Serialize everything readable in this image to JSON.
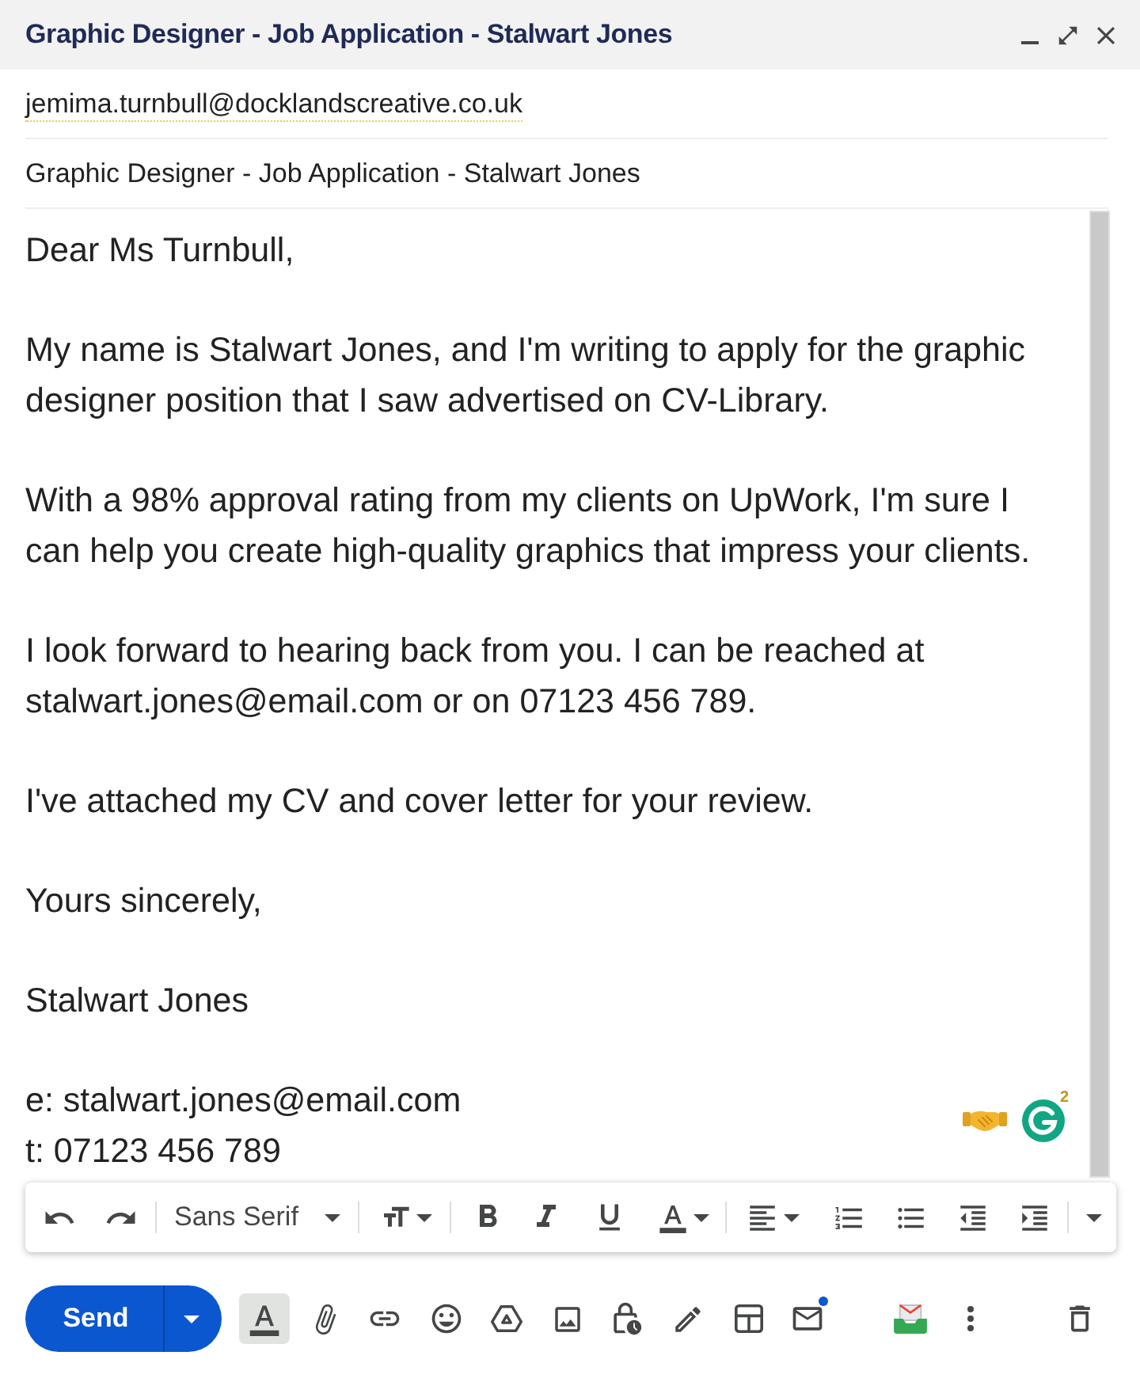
{
  "window": {
    "title": "Graphic Designer - Job Application - Stalwart Jones"
  },
  "recipient": {
    "value": "jemima.turnbull@docklandscreative.co.uk"
  },
  "subject": {
    "value": "Graphic Designer - Job Application - Stalwart Jones"
  },
  "body": {
    "paragraphs": [
      "Dear Ms Turnbull,",
      "My name is Stalwart Jones, and I'm writing to apply for the graphic designer position that I saw advertised on CV-Library.",
      "With a 98% approval rating from my clients on UpWork, I'm sure I can help you create high-quality graphics that impress your clients.",
      "I look forward to hearing back from you. I can be reached at stalwart.jones@email.com or on 07123 456 789.",
      "I've attached my CV and cover letter for your review.",
      "Yours sincerely,",
      "Stalwart Jones"
    ],
    "signature_lines": [
      "e: stalwart.jones@email.com",
      "t: 07123 456 789"
    ]
  },
  "assistant": {
    "badge": "2"
  },
  "format_toolbar": {
    "font": "Sans Serif"
  },
  "bottom_bar": {
    "send": "Send",
    "formatting_button": {
      "selected": true
    }
  }
}
